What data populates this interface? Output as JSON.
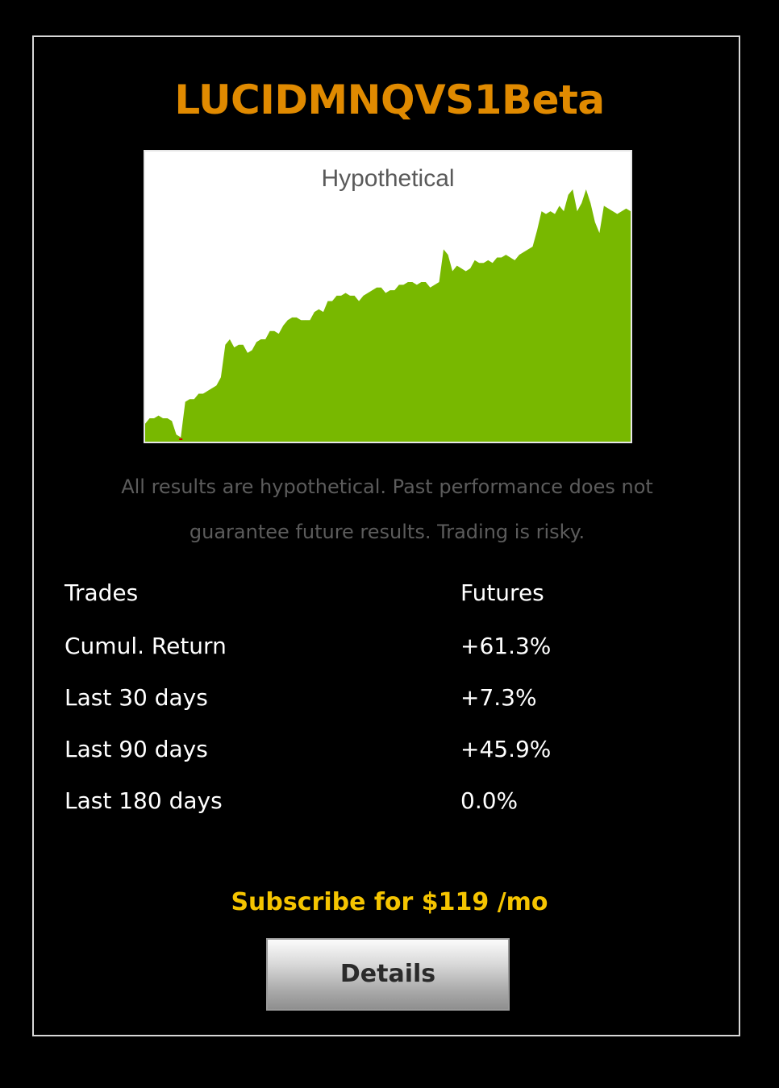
{
  "strategy": {
    "name": "LUCIDMNQVS1Beta"
  },
  "chart": {
    "label": "Hypothetical",
    "fill_color": "#78b800",
    "background": "#ffffff"
  },
  "chart_data": {
    "type": "area",
    "title": "Hypothetical",
    "xlabel": "",
    "ylabel": "",
    "grid": false,
    "legend": "none",
    "ylim": [
      0,
      100
    ],
    "x": [
      0,
      1,
      2,
      3,
      4,
      5,
      6,
      7,
      8,
      9,
      10,
      11,
      12,
      13,
      14,
      15,
      16,
      17,
      18,
      19,
      20,
      21,
      22,
      23,
      24,
      25,
      26,
      27,
      28,
      29,
      30,
      31,
      32,
      33,
      34,
      35,
      36,
      37,
      38,
      39,
      40,
      41,
      42,
      43,
      44,
      45,
      46,
      47,
      48,
      49,
      50,
      51,
      52,
      53,
      54,
      55,
      56,
      57,
      58,
      59,
      60,
      61,
      62,
      63,
      64,
      65,
      66,
      67,
      68,
      69,
      70,
      71,
      72,
      73,
      74,
      75,
      76,
      77,
      78,
      79,
      80,
      81,
      82,
      83,
      84,
      85,
      86,
      87,
      88,
      89,
      90,
      91,
      92,
      93,
      94,
      95,
      96,
      97,
      98,
      99,
      100
    ],
    "series": [
      {
        "values": [
          6,
          8,
          8,
          9,
          8,
          8,
          7,
          2,
          1,
          14,
          15,
          15,
          17,
          17,
          18,
          19,
          20,
          23,
          35,
          37,
          34,
          35,
          35,
          32,
          33,
          36,
          37,
          37,
          40,
          40,
          39,
          42,
          44,
          45,
          45,
          44,
          44,
          44,
          47,
          48,
          47,
          51,
          51,
          53,
          53,
          54,
          53,
          53,
          51,
          53,
          54,
          55,
          56,
          56,
          54,
          55,
          55,
          57,
          57,
          58,
          58,
          57,
          58,
          58,
          56,
          57,
          58,
          70,
          68,
          62,
          64,
          63,
          62,
          63,
          66,
          65,
          65,
          66,
          65,
          67,
          67,
          68,
          67,
          66,
          68,
          69,
          70,
          71,
          77,
          84,
          83,
          84,
          83,
          86,
          84,
          90,
          92,
          84,
          87,
          92,
          87,
          80,
          76,
          86,
          85,
          84,
          83,
          84,
          85,
          84
        ]
      }
    ]
  },
  "disclaimer": {
    "line1": "All results are hypothetical. Past performance does not",
    "line2": "guarantee future results. Trading is risky."
  },
  "stats": [
    {
      "label": "Trades",
      "value": "Futures"
    },
    {
      "label": "Cumul. Return",
      "value": "+61.3%"
    },
    {
      "label": "Last 30 days",
      "value": "+7.3%"
    },
    {
      "label": "Last 90 days",
      "value": "+45.9%"
    },
    {
      "label": "Last 180 days",
      "value": "0.0%"
    }
  ],
  "subscribe": {
    "text": "Subscribe for $119 /mo"
  },
  "details_button": {
    "label": "Details"
  }
}
